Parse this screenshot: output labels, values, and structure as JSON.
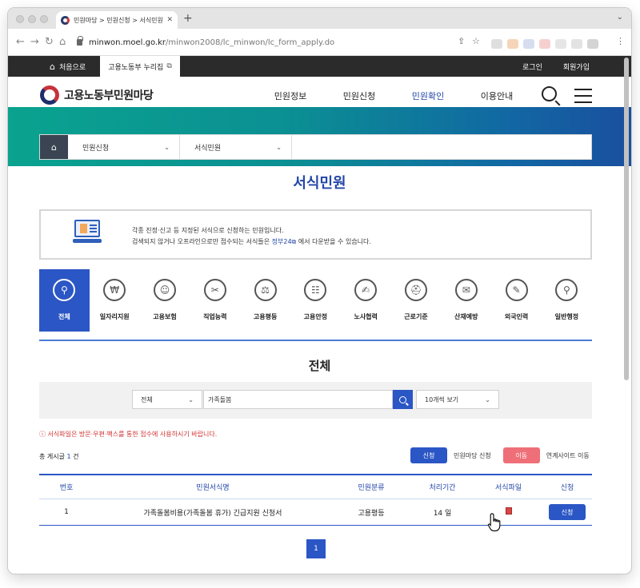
{
  "browser": {
    "tab_title": "민원마당 > 민원신청 > 서식민원",
    "url_host": "minwon.moel.go.kr",
    "url_path": "/minwon2008/lc_minwon/lc_form_apply.do"
  },
  "topbar": {
    "home_label": "처음으로",
    "portal_label": "고용노동부 누리집",
    "login": "로그인",
    "signup": "회원가입"
  },
  "header": {
    "logo_text": "고용노동부민원마당",
    "nav": [
      "민원정보",
      "민원신청",
      "민원확인",
      "이용안내"
    ],
    "active_nav": "민원확인"
  },
  "breadcrumb": {
    "level1": "민원신청",
    "level2": "서식민원"
  },
  "page_title": "서식민원",
  "info": {
    "line1": "각종 진정·신고 등 지정된 서식으로 신청하는 민원입니다.",
    "line2_pre": "검색되지 않거나 오프라인으로만 접수되는 서식들은",
    "line2_link": "정부24",
    "line2_post": "에서 다운받을 수 있습니다."
  },
  "categories": [
    {
      "label": "전체",
      "icon": "search-person-icon",
      "glyph": "⚲",
      "active": true
    },
    {
      "label": "일자리지원",
      "icon": "document-pen-icon",
      "glyph": "₩",
      "active": false
    },
    {
      "label": "고용보험",
      "icon": "shield-gear-icon",
      "glyph": "☺",
      "active": false
    },
    {
      "label": "직업능력",
      "icon": "tools-icon",
      "glyph": "✂",
      "active": false
    },
    {
      "label": "고용평등",
      "icon": "globe-people-icon",
      "glyph": "⚖",
      "active": false
    },
    {
      "label": "고용안정",
      "icon": "group-icon",
      "glyph": "☷",
      "active": false
    },
    {
      "label": "노사협력",
      "icon": "agreement-icon",
      "glyph": "✍",
      "active": false
    },
    {
      "label": "근로기준",
      "icon": "helmet-icon",
      "glyph": "⛑",
      "active": false
    },
    {
      "label": "산재예방",
      "icon": "mail-people-icon",
      "glyph": "✉",
      "active": false
    },
    {
      "label": "외국인력",
      "icon": "form-pen-icon",
      "glyph": "✎",
      "active": false
    },
    {
      "label": "일반행정",
      "icon": "admin-person-icon",
      "glyph": "⚲",
      "active": false
    }
  ],
  "section_title": "전체",
  "search": {
    "category_value": "전체",
    "keyword": "가족돌봄",
    "page_size": "10개씩 보기"
  },
  "notice": "ⓘ 서식파일은 방문·우편·팩스를 통한 접수에 사용하시기 바랍니다.",
  "total": {
    "prefix": "총 게시글",
    "count": "1",
    "suffix": "건"
  },
  "legend": {
    "apply_btn": "신청",
    "apply_desc": "민원마당 신청",
    "move_btn": "이동",
    "move_desc": "연계사이트 이동"
  },
  "table": {
    "headers": [
      "번호",
      "민원서식명",
      "민원분류",
      "처리기간",
      "서식파일",
      "신청"
    ],
    "rows": [
      {
        "no": "1",
        "name": "가족돌봄비용(가족돌봄 휴가) 긴급지원 신청서",
        "category": "고용평등",
        "period": "14 일",
        "apply": "신청"
      }
    ]
  },
  "pager": {
    "current": "1"
  }
}
